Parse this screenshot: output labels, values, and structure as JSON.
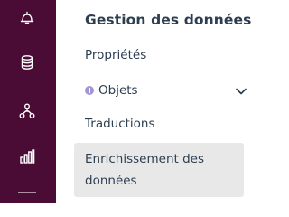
{
  "colors": {
    "rail_background": "#4a0b34",
    "text": "#2d3e50",
    "selected_background": "#e8e8e8",
    "info_badge": "#a394d6"
  },
  "rail": {
    "icons": [
      {
        "name": "bell-icon"
      },
      {
        "name": "database-icon"
      },
      {
        "name": "hierarchy-icon"
      },
      {
        "name": "bar-chart-icon"
      }
    ]
  },
  "panel": {
    "title": "Gestion des données",
    "items": [
      {
        "label": "Propriétés",
        "icon": null,
        "expandable": false,
        "selected": false
      },
      {
        "label": "Objets",
        "icon": "info-badge-icon",
        "expandable": true,
        "selected": false
      },
      {
        "label": "Traductions",
        "icon": null,
        "expandable": false,
        "selected": false
      },
      {
        "label": "Enrichissement des données",
        "icon": null,
        "expandable": false,
        "selected": true
      }
    ]
  }
}
